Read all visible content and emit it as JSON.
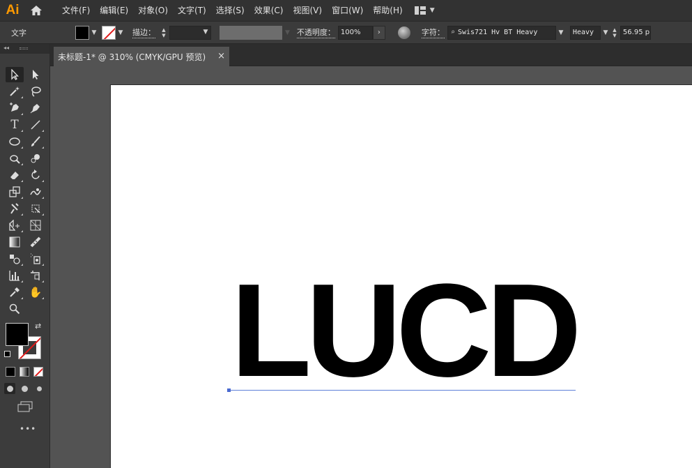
{
  "app": {
    "logo": "Ai"
  },
  "menubar": {
    "items": [
      "文件(F)",
      "编辑(E)",
      "对象(O)",
      "文字(T)",
      "选择(S)",
      "效果(C)",
      "视图(V)",
      "窗口(W)",
      "帮助(H)"
    ]
  },
  "controlbar": {
    "tool_label": "文字",
    "stroke_label": "描边：",
    "opacity_label": "不透明度：",
    "opacity_value": "100%",
    "char_label": "字符：",
    "font_family": "Swis721 Hv BT Heavy",
    "font_style": "Heavy",
    "font_size": "56.95 p"
  },
  "toolbar": {
    "collapse_label": "◂◂",
    "more_label": "•••"
  },
  "document": {
    "tab_title": "未标题-1* @ 310% (CMYK/GPU 预览)",
    "close_label": "×"
  },
  "artwork": {
    "text": "LUCD",
    "text_color": "#000000",
    "baseline_color": "#5d7fd8"
  }
}
